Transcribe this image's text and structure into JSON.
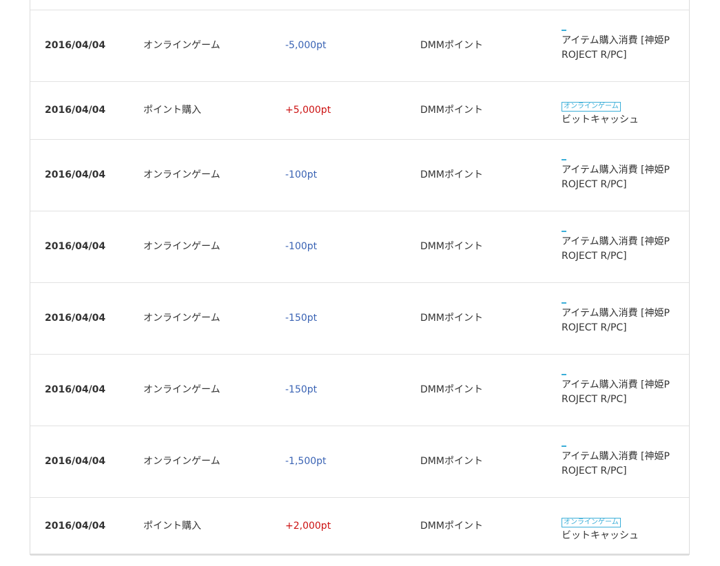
{
  "rows": [
    {
      "date": "2016/04/04",
      "type": "オンラインゲーム",
      "amount": "-5,000pt",
      "sign": "neg",
      "method": "DMMポイント",
      "detail_kind": "dash",
      "detail_line1": "アイテム購入消費 [神姫P",
      "detail_line2": "ROJECT R/PC]",
      "tag": ""
    },
    {
      "date": "2016/04/04",
      "type": "ポイント購入",
      "amount": "+5,000pt",
      "sign": "pos",
      "method": "DMMポイント",
      "detail_kind": "tag",
      "detail_line1": "ビットキャッシュ",
      "detail_line2": "",
      "tag": "オンラインゲーム"
    },
    {
      "date": "2016/04/04",
      "type": "オンラインゲーム",
      "amount": "-100pt",
      "sign": "neg",
      "method": "DMMポイント",
      "detail_kind": "dash",
      "detail_line1": "アイテム購入消費 [神姫P",
      "detail_line2": "ROJECT R/PC]",
      "tag": ""
    },
    {
      "date": "2016/04/04",
      "type": "オンラインゲーム",
      "amount": "-100pt",
      "sign": "neg",
      "method": "DMMポイント",
      "detail_kind": "dash",
      "detail_line1": "アイテム購入消費 [神姫P",
      "detail_line2": "ROJECT R/PC]",
      "tag": ""
    },
    {
      "date": "2016/04/04",
      "type": "オンラインゲーム",
      "amount": "-150pt",
      "sign": "neg",
      "method": "DMMポイント",
      "detail_kind": "dash",
      "detail_line1": "アイテム購入消費 [神姫P",
      "detail_line2": "ROJECT R/PC]",
      "tag": ""
    },
    {
      "date": "2016/04/04",
      "type": "オンラインゲーム",
      "amount": "-150pt",
      "sign": "neg",
      "method": "DMMポイント",
      "detail_kind": "dash",
      "detail_line1": "アイテム購入消費 [神姫P",
      "detail_line2": "ROJECT R/PC]",
      "tag": ""
    },
    {
      "date": "2016/04/04",
      "type": "オンラインゲーム",
      "amount": "-1,500pt",
      "sign": "neg",
      "method": "DMMポイント",
      "detail_kind": "dash",
      "detail_line1": "アイテム購入消費 [神姫P",
      "detail_line2": "ROJECT R/PC]",
      "tag": ""
    },
    {
      "date": "2016/04/04",
      "type": "ポイント購入",
      "amount": "+2,000pt",
      "sign": "pos",
      "method": "DMMポイント",
      "detail_kind": "tag",
      "detail_line1": "ビットキャッシュ",
      "detail_line2": "",
      "tag": "オンラインゲーム"
    }
  ],
  "colors": {
    "negative": "#3a63b4",
    "positive": "#cc1111",
    "link": "#3aaed8",
    "border": "#e2e2e2"
  }
}
